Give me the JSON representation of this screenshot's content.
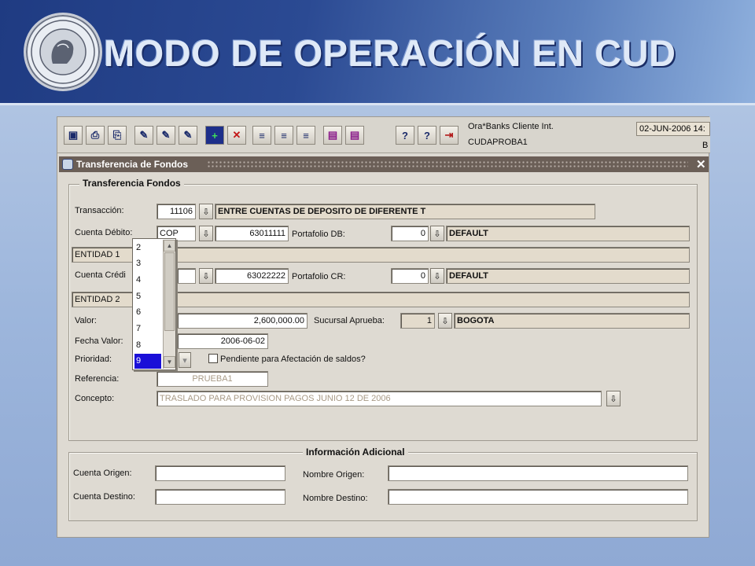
{
  "slide": {
    "title": "MODO DE OPERACIÓN EN CUD",
    "seal_alt": "BANCO DE LA REPUBLICA COLOMBIA"
  },
  "toolbar": {
    "app_name": "Ora*Banks Cliente Int.",
    "user": "CUDAPROBA1",
    "date": "02-JUN-2006 14:",
    "right_letter": "B",
    "buttons": [
      "save",
      "print",
      "print-preview",
      "edit-1",
      "edit-2",
      "edit-3",
      "new-record",
      "delete-record",
      "nav-1",
      "nav-2",
      "nav-3",
      "query-1",
      "query-2",
      "help",
      "help-2",
      "exit"
    ]
  },
  "window": {
    "title": "Transferencia de Fondos",
    "close_label": "✕"
  },
  "group1": {
    "legend": "Transferencia Fondos",
    "transaccion_label": "Transacción:",
    "transaccion_code": "11106",
    "transaccion_desc": "ENTRE CUENTAS DE DEPOSITO DE DIFERENTE T",
    "cuenta_debito_label": "Cuenta Débito:",
    "cuenta_debito_currency": "COP",
    "cuenta_debito_number": "63011111",
    "portafolio_db_label": "Portafolio DB:",
    "portafolio_db_value": "0",
    "portafolio_db_desc": "DEFAULT",
    "entidad1": "ENTIDAD 1",
    "cuenta_credito_label": "Cuenta Crédi",
    "cuenta_credito_number": "63022222",
    "portafolio_cr_label": "Portafolio CR:",
    "portafolio_cr_value": "0",
    "portafolio_cr_desc": "DEFAULT",
    "entidad2": "ENTIDAD 2",
    "valor_label": "Valor:",
    "valor_value": "2,600,000.00",
    "sucursal_label": "Sucursal Aprueba:",
    "sucursal_value": "1",
    "sucursal_desc": "BOGOTA",
    "fecha_label": "Fecha Valor:",
    "fecha_value": "2006-06-02",
    "prioridad_label": "Prioridad:",
    "pendiente_label": "Pendiente para Afectación de saldos?",
    "referencia_label": "Referencia:",
    "referencia_value": "PRUEBA1",
    "concepto_label": "Concepto:",
    "concepto_value": "TRASLADO PARA PROVISION PAGOS JUNIO 12 DE 2006"
  },
  "dropdown": {
    "items": [
      "2",
      "3",
      "4",
      "5",
      "6",
      "7",
      "8",
      "9"
    ],
    "selected": "9"
  },
  "group2": {
    "legend": "Información Adicional",
    "cuenta_origen_label": "Cuenta Origen:",
    "cuenta_destino_label": "Cuenta Destino:",
    "nombre_origen_label": "Nombre Origen:",
    "nombre_destino_label": "Nombre Destino:"
  }
}
